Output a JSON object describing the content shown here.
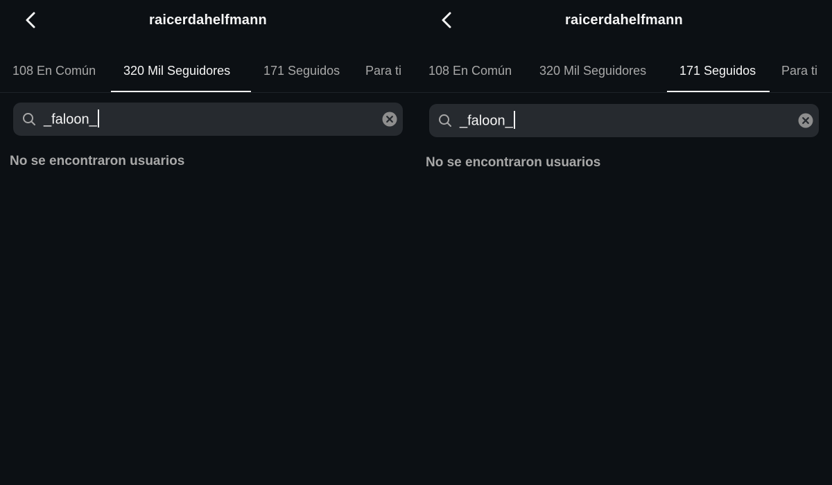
{
  "colors": {
    "background": "#0c1014",
    "search_bg": "#262a2f",
    "text_primary": "#f5f5f5",
    "text_secondary": "#a8a8a8"
  },
  "panels": [
    {
      "header": {
        "back_icon": "chevron-left-icon",
        "title": "raicerdahelfmann"
      },
      "tabs": [
        {
          "label": "108 En Común",
          "active": false
        },
        {
          "label": "320 Mil Seguidores",
          "active": true
        },
        {
          "label": "171 Seguidos",
          "active": false
        },
        {
          "label": "Para ti",
          "active": false
        }
      ],
      "search": {
        "icon": "search-icon",
        "value": "_faloon_",
        "clear_icon": "clear-icon"
      },
      "empty_message": "No se encontraron usuarios"
    },
    {
      "header": {
        "back_icon": "chevron-left-icon",
        "title": "raicerdahelfmann"
      },
      "tabs": [
        {
          "label": "108 En Común",
          "active": false
        },
        {
          "label": "320 Mil Seguidores",
          "active": false
        },
        {
          "label": "171 Seguidos",
          "active": true
        },
        {
          "label": "Para ti",
          "active": false
        }
      ],
      "search": {
        "icon": "search-icon",
        "value": "_faloon_",
        "clear_icon": "clear-icon"
      },
      "empty_message": "No se encontraron usuarios"
    }
  ]
}
